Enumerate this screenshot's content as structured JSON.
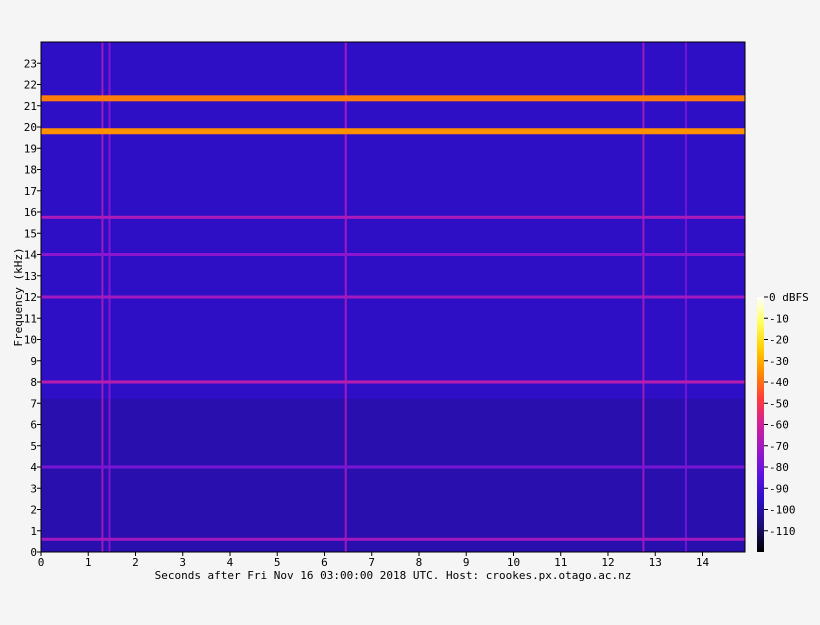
{
  "chart_data": {
    "type": "heatmap",
    "subtype": "spectrogram",
    "xlabel": "Seconds after Fri Nov 16 03:00:00 2018 UTC. Host: crookes.px.otago.ac.nz",
    "ylabel": "Frequency (kHz)",
    "xlim": [
      0,
      14.9
    ],
    "ylim": [
      0,
      24
    ],
    "x_ticks": [
      0,
      1,
      2,
      3,
      4,
      5,
      6,
      7,
      8,
      9,
      10,
      11,
      12,
      13,
      14
    ],
    "y_ticks": [
      0,
      1,
      2,
      3,
      4,
      5,
      6,
      7,
      8,
      9,
      10,
      11,
      12,
      13,
      14,
      15,
      16,
      17,
      18,
      19,
      20,
      21,
      22,
      23
    ],
    "colorbar": {
      "unit": "dBFS",
      "range": [
        -120,
        0
      ],
      "ticks": [
        0,
        -10,
        -20,
        -30,
        -40,
        -50,
        -60,
        -70,
        -80,
        -90,
        -100,
        -110
      ],
      "tick_labels": [
        "0 dBFS",
        "-10",
        "-20",
        "-30",
        "-40",
        "-50",
        "-60",
        "-70",
        "-80",
        "-90",
        "-100",
        "-110"
      ],
      "colormap": [
        "#000000",
        "#1a0f6e",
        "#2b0fc2",
        "#5a12e0",
        "#9a18c8",
        "#d0209a",
        "#ff3a3a",
        "#ff8a00",
        "#ffd000",
        "#ffff60",
        "#ffffff"
      ]
    },
    "background_level_dbfs": -95,
    "horizontal_lines": [
      {
        "freq_khz": 21.35,
        "level_dbfs": -38
      },
      {
        "freq_khz": 19.8,
        "level_dbfs": -35
      },
      {
        "freq_khz": 15.75,
        "level_dbfs": -68
      },
      {
        "freq_khz": 14.0,
        "level_dbfs": -75
      },
      {
        "freq_khz": 12.0,
        "level_dbfs": -70
      },
      {
        "freq_khz": 8.0,
        "level_dbfs": -65
      },
      {
        "freq_khz": 4.0,
        "level_dbfs": -78
      },
      {
        "freq_khz": 0.6,
        "level_dbfs": -70
      }
    ],
    "vertical_lines": [
      {
        "time_s": 1.3,
        "level_dbfs": -68
      },
      {
        "time_s": 1.45,
        "level_dbfs": -75
      },
      {
        "time_s": 6.45,
        "level_dbfs": -68
      },
      {
        "time_s": 12.75,
        "level_dbfs": -68
      },
      {
        "time_s": 13.65,
        "level_dbfs": -78
      }
    ]
  }
}
